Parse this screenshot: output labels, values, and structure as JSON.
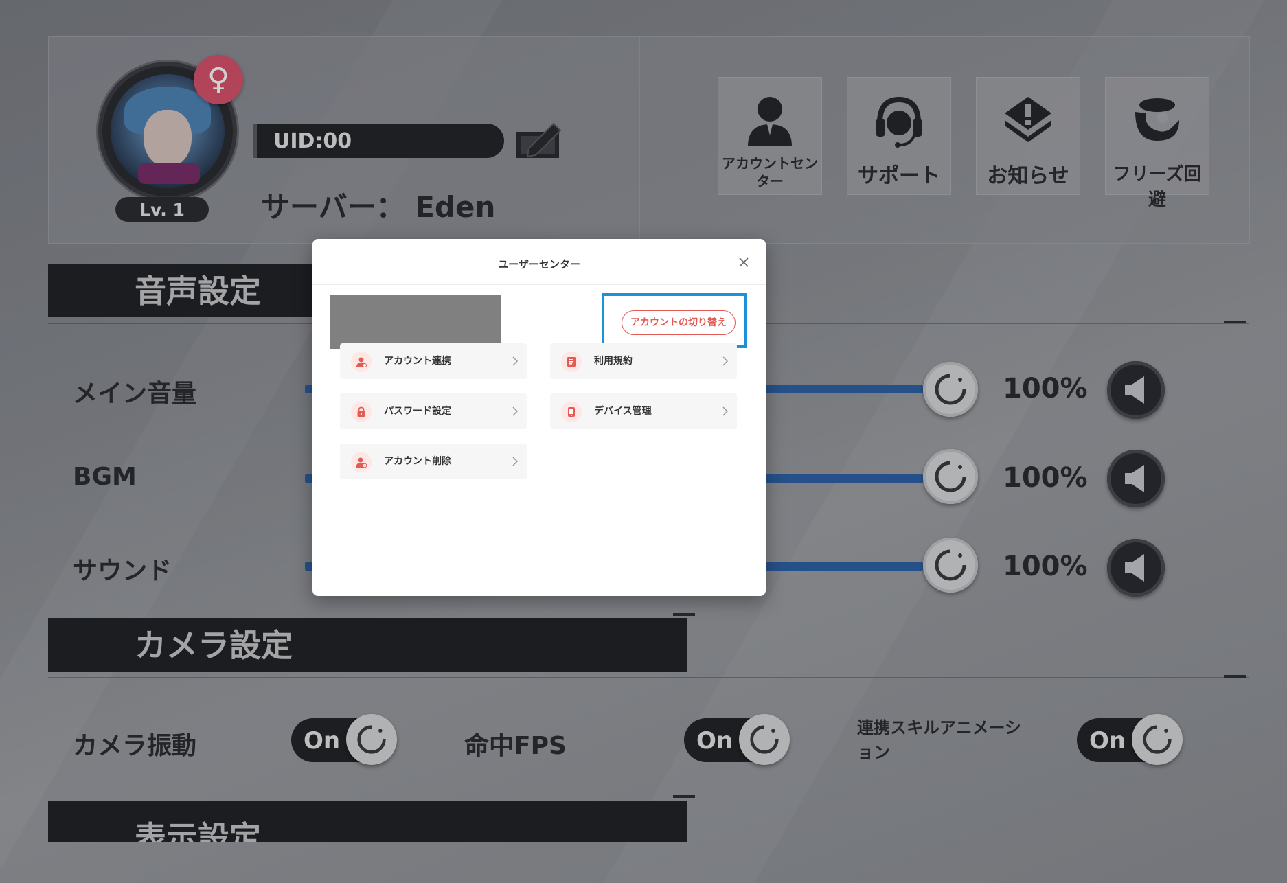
{
  "profile": {
    "gender_symbol": "♀",
    "level": "Lv. 1",
    "uid": "UID:00",
    "server": "サーバー：  Eden"
  },
  "quick_actions": [
    {
      "label": "アカウントセン\nター",
      "icon": "account-center-icon"
    },
    {
      "label": "サポート",
      "icon": "headset-icon"
    },
    {
      "label": "お知らせ",
      "icon": "notice-icon"
    },
    {
      "label": "フリーズ回避",
      "icon": "freeze-avoid-icon"
    }
  ],
  "sections": {
    "audio": "音声設定",
    "camera": "カメラ設定",
    "display": "表示設定"
  },
  "audio_rows": [
    {
      "label": "メイン音量",
      "value": "100%",
      "level": 1.0
    },
    {
      "label": "BGM",
      "value": "100%",
      "level": 1.0
    },
    {
      "label": "サウンド",
      "value": "100%",
      "level": 1.0
    }
  ],
  "camera_rows": [
    {
      "label": "カメラ振動",
      "state": "On"
    },
    {
      "label": "命中FPS",
      "state": "On"
    },
    {
      "label": "連携スキルアニメーシ\nョン",
      "state": "On"
    }
  ],
  "modal": {
    "title": "ユーザーセンター",
    "switch_account": "アカウントの切り替え",
    "items": [
      {
        "label": "アカウント連携",
        "icon": "user-link-icon"
      },
      {
        "label": "利用規約",
        "icon": "terms-icon"
      },
      {
        "label": "パスワード設定",
        "icon": "lock-icon"
      },
      {
        "label": "デバイス管理",
        "icon": "device-icon"
      },
      {
        "label": "アカウント削除",
        "icon": "user-delete-icon"
      }
    ]
  },
  "colors": {
    "accent_red": "#e45a55",
    "highlight_blue": "#1e90d8",
    "slider_blue": "#2f62a8"
  }
}
